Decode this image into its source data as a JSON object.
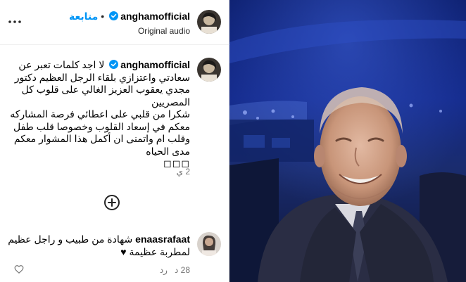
{
  "header": {
    "username": "anghamofficial",
    "separator": "•",
    "follow_label": "متابعة",
    "audio_label": "Original audio"
  },
  "caption": {
    "username": "anghamofficial",
    "lines": [
      "لا اجد كلمات تعبر عن سعادتي واعتزازي بلقاء الرجل العظيم دكتور مجدي يعقوب العزيز الغالي على قلوب كل المصريين",
      "شكرا من قلبي على اعطائي فرصة المشاركه معكم في إسعاد القلوب وخصوصا قلب طفل وقلب ام واتمنى ان أكمل هذا المشوار معكم مدى الحياه"
    ],
    "hearts": "◻◻◻",
    "time": "2 ي"
  },
  "comment": {
    "username": "enaasrafaat",
    "text": "شهادة من طبيب و راجل عظيم لمطربة عظيمة ♥",
    "time": "28 د",
    "reply_label": "رد"
  },
  "icons": {
    "more": "more-horizontal-icon",
    "verified": "verified-badge-icon",
    "add": "add-circle-icon",
    "like": "heart-icon"
  },
  "colors": {
    "link_blue": "#0095f6",
    "verified_blue": "#0095f6",
    "muted_text": "#737373",
    "divider": "#dbdbdb"
  }
}
